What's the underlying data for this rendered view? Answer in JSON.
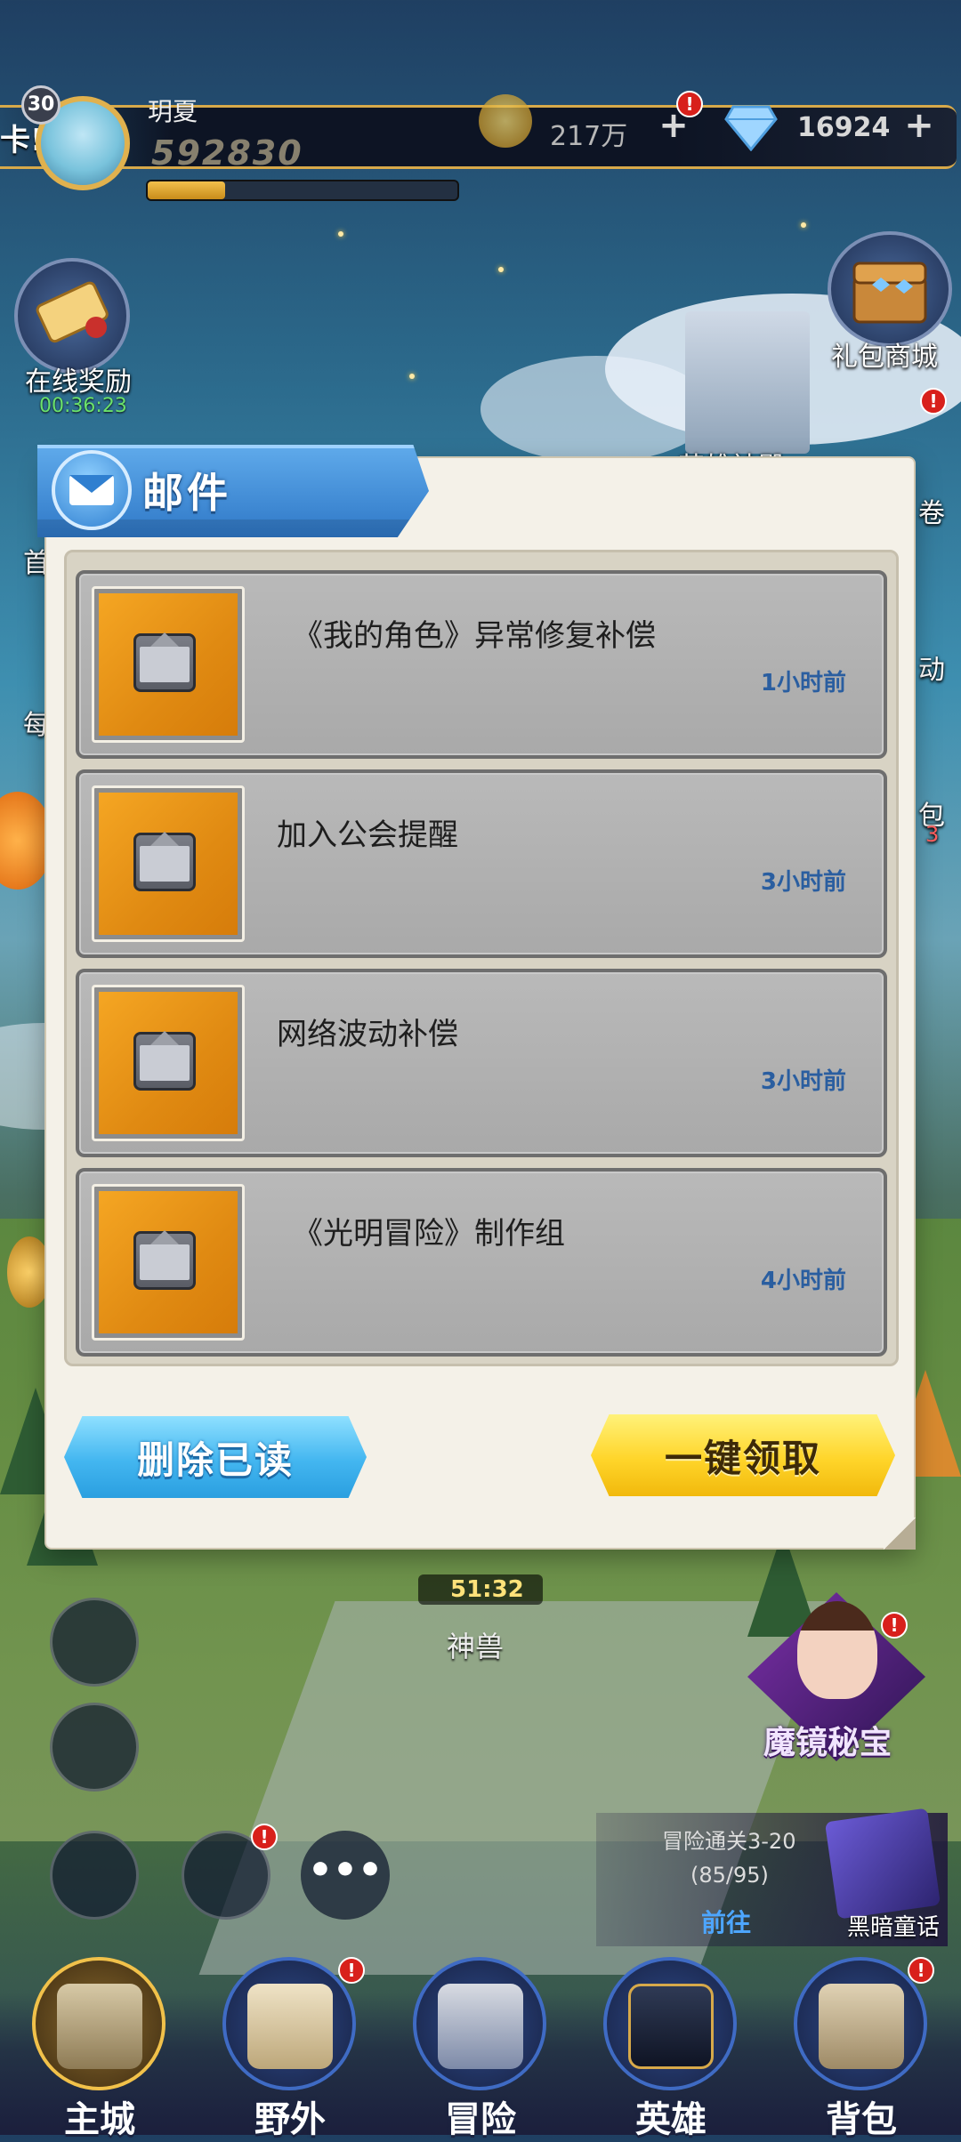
{
  "hud": {
    "marquee_text": "卡!",
    "level": "30",
    "player_name": "玥夏",
    "power": "592830",
    "gold": "217万",
    "gems": "16924",
    "plus": "+"
  },
  "side_buttons": {
    "online_reward": "在线奖励",
    "online_timer": "00:36:23",
    "gift_shop": "礼包商城",
    "hero_temple": "英雄神殿",
    "partial_left_1": "首",
    "partial_left_2": "每",
    "partial_right_1": "卷",
    "partial_right_2": "动",
    "partial_right_3": "包",
    "partial_right_3_num": "3"
  },
  "dialog": {
    "title": "邮件",
    "mails": [
      {
        "subject": "《我的角色》异常修复补偿",
        "time": "1小时前"
      },
      {
        "subject": "加入公会提醒",
        "time": "3小时前"
      },
      {
        "subject": "网络波动补偿",
        "time": "3小时前"
      },
      {
        "subject": "《光明冒险》制作组",
        "time": "4小时前"
      }
    ],
    "delete_read_label": "删除已读",
    "claim_all_label": "一键领取"
  },
  "lower_hud": {
    "boss_timer": "51:32",
    "boss_label": "神兽",
    "more_label": "•••",
    "mirror_event_label": "魔镜秘宝",
    "quest_title": "冒险通关3-20",
    "quest_progress": "(85/95)",
    "quest_go": "前往",
    "quest_book_label": "黑暗童话"
  },
  "nav": {
    "items": [
      {
        "label": "主城"
      },
      {
        "label": "野外"
      },
      {
        "label": "冒险"
      },
      {
        "label": "英雄"
      },
      {
        "label": "背包"
      }
    ]
  },
  "colors": {
    "accent_gold": "#d7a94a",
    "time_blue": "#2a5ea0",
    "alert_red": "#d8201b"
  }
}
